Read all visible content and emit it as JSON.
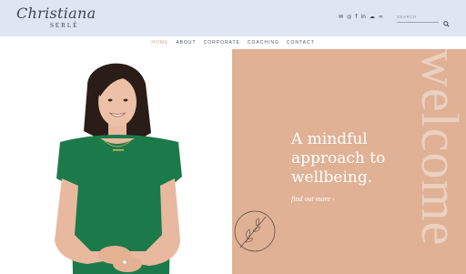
{
  "brand": {
    "script": "Christiana",
    "sub": "SERLÉ"
  },
  "social": [
    {
      "icon": "email-icon",
      "glyph": "✉"
    },
    {
      "icon": "instagram-icon",
      "glyph": "◎"
    },
    {
      "icon": "facebook-icon",
      "glyph": "f"
    },
    {
      "icon": "linkedin-icon",
      "glyph": "in"
    },
    {
      "icon": "soundcloud-icon",
      "glyph": "☁"
    },
    {
      "icon": "podcast-icon",
      "glyph": "∞"
    }
  ],
  "search": {
    "placeholder": "SEARCH"
  },
  "nav": {
    "items": [
      "HOME",
      "ABOUT",
      "CORPORATE",
      "COACHING",
      "CONTACT"
    ],
    "active": "HOME"
  },
  "hero": {
    "headline_lines": [
      "A mindful",
      "approach to",
      "wellbeing."
    ],
    "cta": "find out more",
    "cta_arrow": "›",
    "side_word": "welcome"
  },
  "colors": {
    "header_bg": "#dde6f1",
    "peach": "#e0b194",
    "accent": "#d9a187",
    "dress": "#1c7a4a"
  }
}
